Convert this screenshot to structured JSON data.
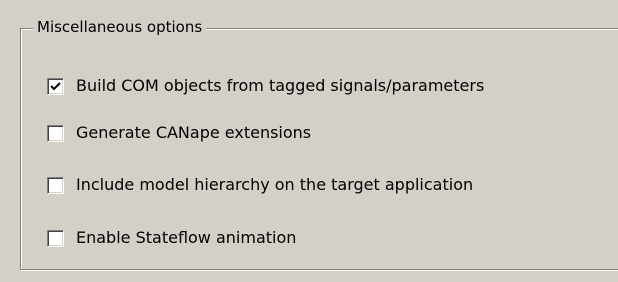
{
  "group": {
    "title": "Miscellaneous options"
  },
  "options": [
    {
      "label": "Build COM objects from tagged signals/parameters",
      "checked": true
    },
    {
      "label": "Generate CANape extensions",
      "checked": false
    },
    {
      "label": "Include model hierarchy on the target application",
      "checked": false
    },
    {
      "label": "Enable Stateflow animation",
      "checked": false
    }
  ]
}
